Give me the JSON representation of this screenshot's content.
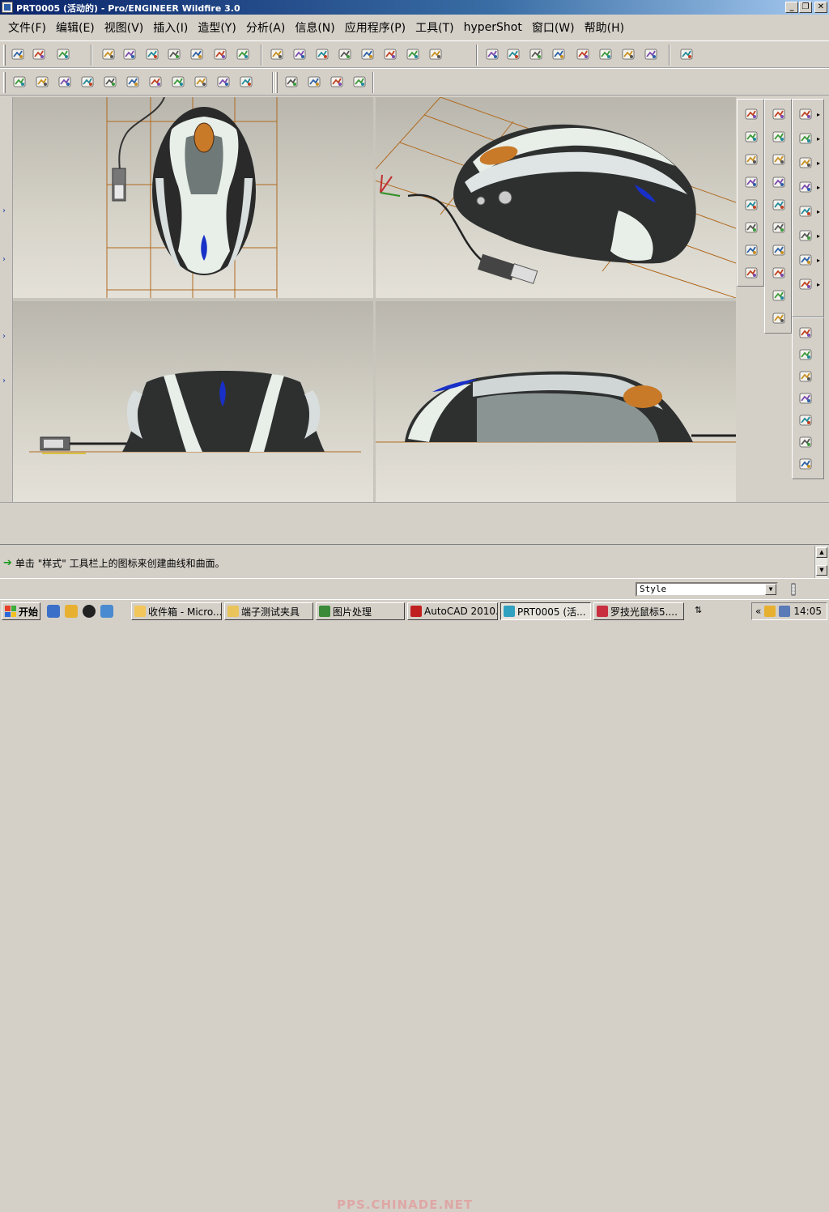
{
  "window": {
    "title": "PRT0005 (活动的) - Pro/ENGINEER Wildfire 3.0",
    "min_label": "_",
    "max_label": "❐",
    "close_label": "✕"
  },
  "menu": {
    "items": [
      {
        "label": "文件(F)"
      },
      {
        "label": "编辑(E)"
      },
      {
        "label": "视图(V)"
      },
      {
        "label": "插入(I)"
      },
      {
        "label": "造型(Y)"
      },
      {
        "label": "分析(A)"
      },
      {
        "label": "信息(N)"
      },
      {
        "label": "应用程序(P)"
      },
      {
        "label": "工具(T)"
      },
      {
        "label": "hyperShot"
      },
      {
        "label": "窗口(W)"
      },
      {
        "label": "帮助(H)"
      }
    ]
  },
  "toolbar_icons": {
    "row1": [
      "regenerate-icon",
      "model-tree-icon",
      "select-box-icon",
      "appearance-icon",
      "render-icon",
      "zoom-in-icon",
      "zoom-out-icon",
      "refit-icon",
      "spin-center-icon",
      "view-manager-icon",
      "saved-view-icon",
      "layers-icon",
      "datum-icon",
      "undo-icon",
      "redo-icon",
      "windows-icon",
      "accept-icon",
      "cancel-icon",
      "wireframe-icon",
      "hidden-line-icon",
      "no-hidden-icon",
      "shading-icon",
      "box-1-icon",
      "box-2-icon",
      "box-3-icon",
      "box-4-icon",
      "grid-toggle-icon"
    ],
    "row2": [
      "curve-analysis-icon",
      "surface-analysis-icon",
      "curvature-icon",
      "reflection-icon",
      "shade-analysis-icon",
      "draft-analysis-icon",
      "slope-icon",
      "section-analysis-icon",
      "offset-analysis-icon",
      "delete-analysis-icon",
      "hide-analysis-icon",
      "sketch-plane-icon",
      "datum-points-icon",
      "datum-cross-icon",
      "datum-plot-icon"
    ]
  },
  "right_icons": {
    "panel1": [
      "new-file-icon",
      "open-file-icon",
      "open-session-icon",
      "save-icon",
      "save-copy-icon",
      "rename-icon",
      "print-icon",
      "close-window-icon"
    ],
    "panel2": [
      "appearance-gallery-icon",
      "lights-icon",
      "room-editor-icon",
      "scene-editor-icon",
      "perspective-icon",
      "rendering-icon",
      "render-setup-icon",
      "decal-icon",
      "render-window-icon",
      "render-region-icon"
    ],
    "panel3": [
      "select-arrow-icon",
      "set-active-plane-icon",
      "curve-tool-icon",
      "surface-tool-icon",
      "curve-edit-icon",
      "section-curve-icon",
      "trim-surface-icon",
      "check-accept-icon"
    ],
    "panel4": [
      "drop-curve-icon",
      "sweep-icon",
      "connect-icon",
      "plane-icon",
      "trim-icon",
      "curve-from-surface-icon",
      "point-icon"
    ]
  },
  "message": {
    "text": "单击 \"样式\" 工具栏上的图标来创建曲线和曲面。"
  },
  "status": {
    "style_value": "Style"
  },
  "taskbar": {
    "start_label": "开始",
    "tasks": [
      {
        "label": "收件箱 - Micro...",
        "color": "#f2c65a"
      },
      {
        "label": "端子测试夹具",
        "color": "#e8c45a"
      },
      {
        "label": "图片处理",
        "color": "#3a8a3a"
      },
      {
        "label": "AutoCAD 2010...",
        "color": "#c02020"
      },
      {
        "label": "PRT0005 (活...",
        "color": "#30a0c0"
      },
      {
        "label": "罗技光鼠标5....",
        "color": "#c83040"
      }
    ],
    "clock": "14:05",
    "watermark": "PPS.CHINADE.NET"
  },
  "colors": {
    "plane_line": "#b06a1e",
    "mouse_dark": "#2a2a2a",
    "mouse_light": "#e8eee8",
    "wheel": "#c87a28",
    "accent_blue": "#1830c8"
  }
}
